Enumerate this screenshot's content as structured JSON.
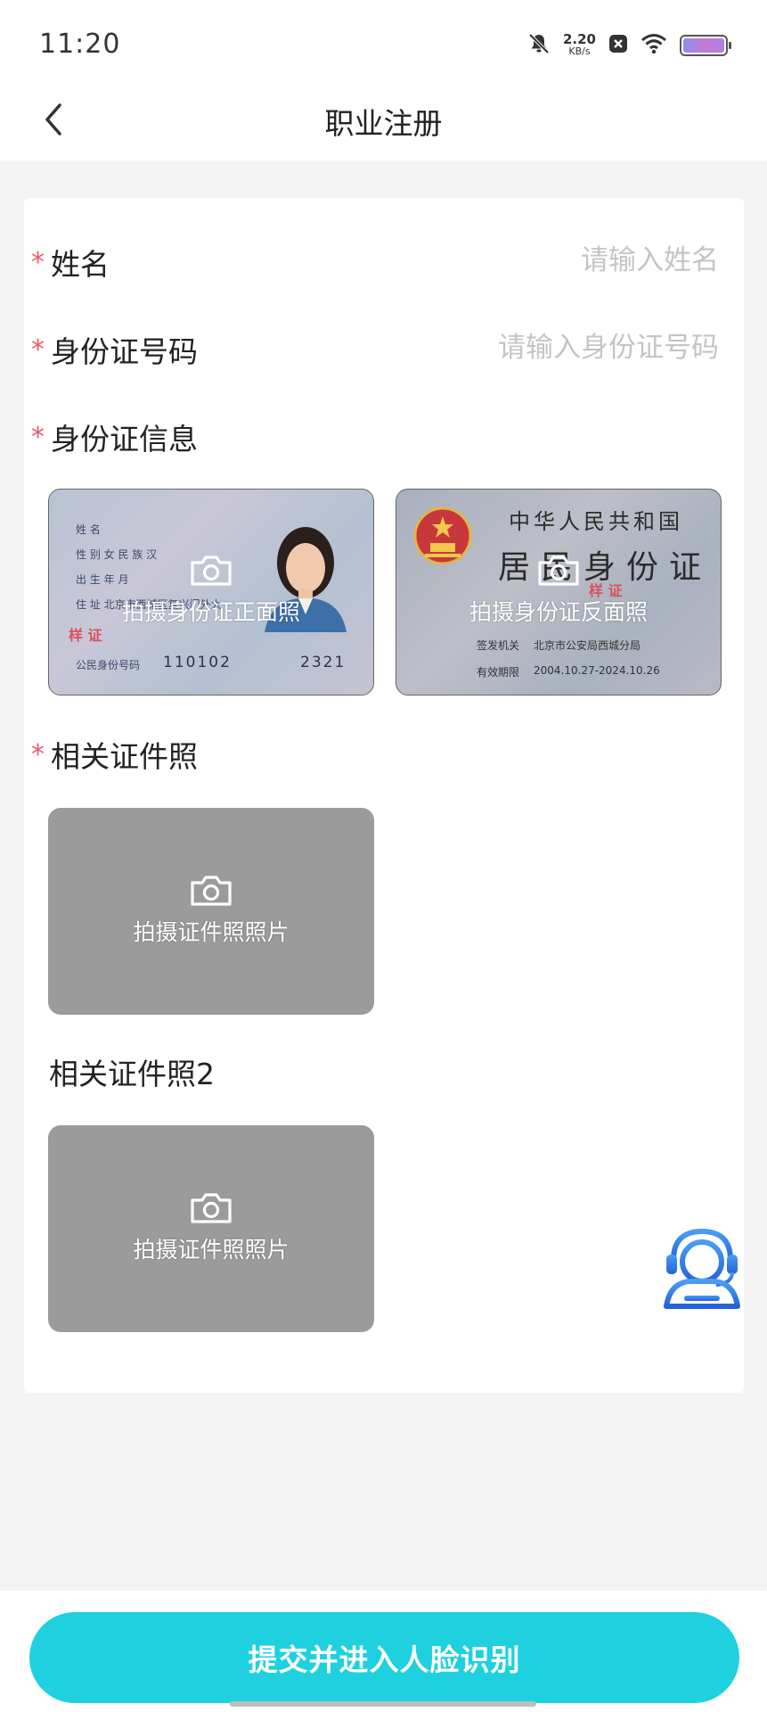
{
  "status_bar": {
    "time": "11:20",
    "speed_value": "2.20",
    "speed_unit": "KB/s",
    "icons": [
      "mute-bell-icon",
      "close-box-icon",
      "wifi-icon",
      "battery-icon"
    ]
  },
  "nav": {
    "title": "职业注册",
    "back_icon": "chevron-left-icon"
  },
  "form": {
    "name_label": "姓名",
    "name_placeholder": "请输入姓名",
    "id_number_label": "身份证号码",
    "id_number_placeholder": "请输入身份证号码",
    "id_info_label": "身份证信息",
    "id_front_caption": "拍摄身份证正面照",
    "id_back_caption": "拍摄身份证反面照",
    "cert_label": "相关证件照",
    "cert_caption": "拍摄证件照照片",
    "cert2_label": "相关证件照2",
    "cert2_caption": "拍摄证件照照片",
    "required_mark": "*"
  },
  "id_front_sample": {
    "lines": [
      "姓 名",
      "性 别  女     民 族 汉",
      "出 生              年      月",
      "住 址   北京市西城区复兴门外大"
    ],
    "number_label": "公民身份号码",
    "number_start": "110102",
    "number_end": "2321",
    "stamp": "样 证"
  },
  "id_back_sample": {
    "country": "中华人民共和国",
    "card_name": "居民身份证",
    "stamp": "样 证",
    "issuer_label": "签发机关",
    "issuer": "北京市公安局西城分局",
    "validity_label": "有效期限",
    "validity": "2004.10.27-2024.10.26"
  },
  "submit": {
    "label": "提交并进入人脸识别"
  },
  "colors": {
    "accent": "#1fd1df",
    "required": "#ee5a6a",
    "tile_grey": "#9b9b9b",
    "support_blue": "#2f7be8"
  }
}
